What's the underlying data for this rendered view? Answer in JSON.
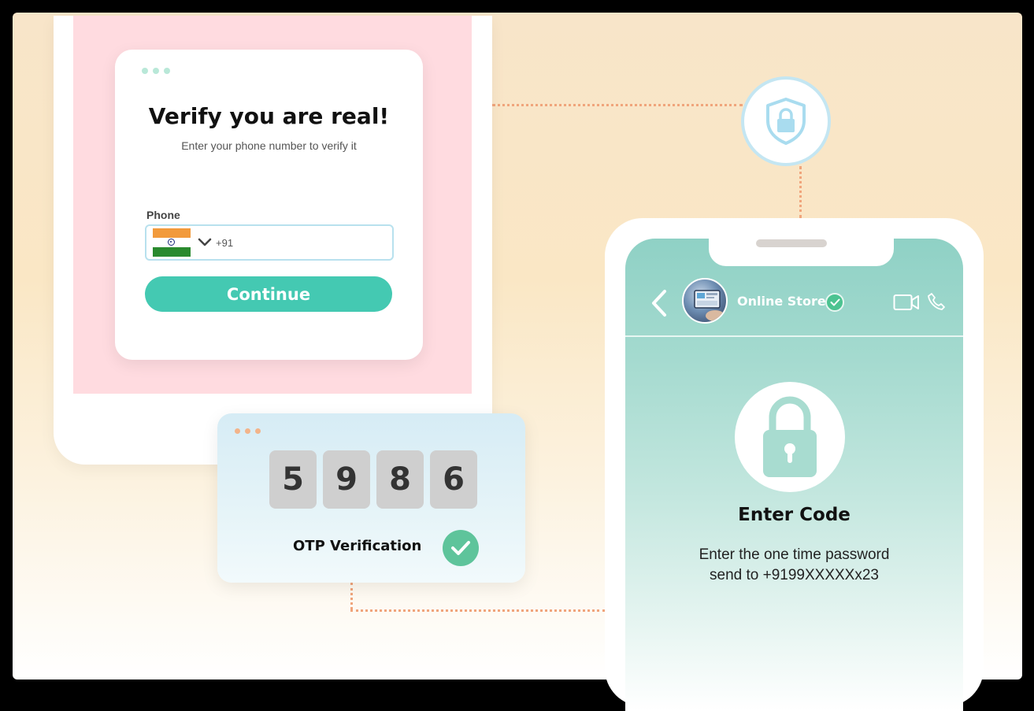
{
  "verify_card": {
    "title": "Verify you are real!",
    "subtitle": "Enter your phone number to verify it",
    "phone_label": "Phone",
    "country_code": "+91",
    "continue_label": "Continue"
  },
  "otp_card": {
    "digits": [
      "5",
      "9",
      "8",
      "6"
    ],
    "label": "OTP Verification"
  },
  "phone_screen": {
    "contact_name": "Online Store",
    "enter_code_title": "Enter Code",
    "description_line1": "Enter the one time password",
    "description_line2": "send to +9199XXXXXx23"
  },
  "colors": {
    "accent": "#44c9b2",
    "tablet_screen": "#ffdbe0",
    "connector": "#f0a57c",
    "check_green": "#5ec49b"
  },
  "icons": [
    "shield-lock-icon",
    "chevron-down-icon",
    "check-icon",
    "back-arrow-icon",
    "verified-badge-icon",
    "video-call-icon",
    "phone-call-icon",
    "padlock-icon",
    "india-flag-icon"
  ]
}
